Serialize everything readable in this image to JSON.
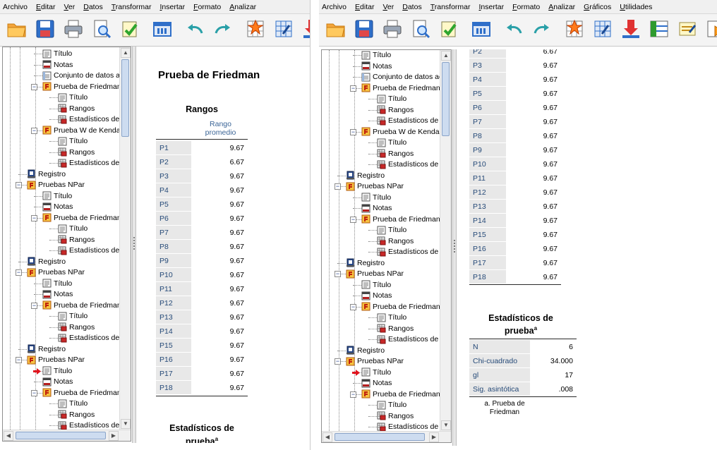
{
  "menu": [
    {
      "pre": "Archivo",
      "u": "",
      "post": ""
    },
    {
      "pre": "",
      "u": "E",
      "post": "ditar"
    },
    {
      "pre": "",
      "u": "V",
      "post": "er"
    },
    {
      "pre": "",
      "u": "D",
      "post": "atos"
    },
    {
      "pre": "",
      "u": "T",
      "post": "ransformar"
    },
    {
      "pre": "",
      "u": "I",
      "post": "nsertar"
    },
    {
      "pre": "",
      "u": "F",
      "post": "ormato"
    },
    {
      "pre": "",
      "u": "A",
      "post": "nalizar"
    },
    {
      "pre": "",
      "u": "G",
      "post": "ráficos"
    },
    {
      "pre": "",
      "u": "U",
      "post": "tilidades"
    }
  ],
  "toolbar_icons": [
    "open-folder-icon",
    "save-icon",
    "print-icon",
    "print-preview-icon",
    "export-icon",
    "dialog-recall-icon",
    "undo-icon",
    "redo-icon",
    "goto-data-icon",
    "goto-case-icon",
    "goto-variable-icon",
    "variables-icon",
    "designate-window-icon",
    "run-script-icon"
  ],
  "tree_left": [
    {
      "label": "Título",
      "level": 2,
      "icon": "title-icon"
    },
    {
      "label": "Notas",
      "level": 2,
      "icon": "notes-icon"
    },
    {
      "label": "Conjunto de datos activo",
      "level": 2,
      "icon": "dataset-icon"
    },
    {
      "label": "Prueba de Friedman",
      "level": 2,
      "icon": "procedure-icon",
      "exp": "-"
    },
    {
      "label": "Título",
      "level": 3,
      "icon": "title-icon"
    },
    {
      "label": "Rangos",
      "level": 3,
      "icon": "table-icon"
    },
    {
      "label": "Estadísticos de prueba",
      "level": 3,
      "icon": "table-icon"
    },
    {
      "label": "Prueba W de Kendall",
      "level": 2,
      "icon": "procedure-icon",
      "exp": "-"
    },
    {
      "label": "Título",
      "level": 3,
      "icon": "title-icon"
    },
    {
      "label": "Rangos",
      "level": 3,
      "icon": "table-icon"
    },
    {
      "label": "Estadísticos de prueba",
      "level": 3,
      "icon": "table-icon"
    },
    {
      "label": "Registro",
      "level": 1,
      "icon": "log-icon"
    },
    {
      "label": "Pruebas NPar",
      "level": 1,
      "icon": "procedure-icon",
      "exp": "-"
    },
    {
      "label": "Título",
      "level": 2,
      "icon": "title-icon"
    },
    {
      "label": "Notas",
      "level": 2,
      "icon": "notes-icon"
    },
    {
      "label": "Prueba de Friedman",
      "level": 2,
      "icon": "procedure-icon",
      "exp": "-"
    },
    {
      "label": "Título",
      "level": 3,
      "icon": "title-icon"
    },
    {
      "label": "Rangos",
      "level": 3,
      "icon": "table-icon"
    },
    {
      "label": "Estadísticos de prueba",
      "level": 3,
      "icon": "table-icon"
    },
    {
      "label": "Registro",
      "level": 1,
      "icon": "log-icon"
    },
    {
      "label": "Pruebas NPar",
      "level": 1,
      "icon": "procedure-icon",
      "exp": "-"
    },
    {
      "label": "Título",
      "level": 2,
      "icon": "title-icon"
    },
    {
      "label": "Notas",
      "level": 2,
      "icon": "notes-icon"
    },
    {
      "label": "Prueba de Friedman",
      "level": 2,
      "icon": "procedure-icon",
      "exp": "-"
    },
    {
      "label": "Título",
      "level": 3,
      "icon": "title-icon"
    },
    {
      "label": "Rangos",
      "level": 3,
      "icon": "table-icon"
    },
    {
      "label": "Estadísticos de prueba",
      "level": 3,
      "icon": "table-icon"
    },
    {
      "label": "Registro",
      "level": 1,
      "icon": "log-icon"
    },
    {
      "label": "Pruebas NPar",
      "level": 1,
      "icon": "procedure-icon",
      "exp": "-"
    },
    {
      "label": "Título",
      "level": 2,
      "icon": "title-icon",
      "current": true
    },
    {
      "label": "Notas",
      "level": 2,
      "icon": "notes-icon"
    },
    {
      "label": "Prueba de Friedman",
      "level": 2,
      "icon": "procedure-icon",
      "exp": "-"
    },
    {
      "label": "Título",
      "level": 3,
      "icon": "title-icon"
    },
    {
      "label": "Rangos",
      "level": 3,
      "icon": "table-icon"
    },
    {
      "label": "Estadísticos de prueba",
      "level": 3,
      "icon": "table-icon"
    }
  ],
  "left_output": {
    "title": "Prueba de Friedman",
    "ranks_title": "Rangos",
    "col_header_1": "Rango",
    "col_header_2": "promedio",
    "rows": [
      {
        "label": "P1",
        "value": "9.67"
      },
      {
        "label": "P2",
        "value": "6.67"
      },
      {
        "label": "P3",
        "value": "9.67"
      },
      {
        "label": "P4",
        "value": "9.67"
      },
      {
        "label": "P5",
        "value": "9.67"
      },
      {
        "label": "P6",
        "value": "9.67"
      },
      {
        "label": "P7",
        "value": "9.67"
      },
      {
        "label": "P8",
        "value": "9.67"
      },
      {
        "label": "P9",
        "value": "9.67"
      },
      {
        "label": "P10",
        "value": "9.67"
      },
      {
        "label": "P11",
        "value": "9.67"
      },
      {
        "label": "P12",
        "value": "9.67"
      },
      {
        "label": "P13",
        "value": "9.67"
      },
      {
        "label": "P14",
        "value": "9.67"
      },
      {
        "label": "P15",
        "value": "9.67"
      },
      {
        "label": "P16",
        "value": "9.67"
      },
      {
        "label": "P17",
        "value": "9.67"
      },
      {
        "label": "P18",
        "value": "9.67"
      }
    ],
    "stats_title_1": "Estadísticos de",
    "stats_title_2": "prueba",
    "stats_sup": "a"
  },
  "right_output": {
    "rows": [
      {
        "label": "P2",
        "value": "6.67"
      },
      {
        "label": "P3",
        "value": "9.67"
      },
      {
        "label": "P4",
        "value": "9.67"
      },
      {
        "label": "P5",
        "value": "9.67"
      },
      {
        "label": "P6",
        "value": "9.67"
      },
      {
        "label": "P7",
        "value": "9.67"
      },
      {
        "label": "P8",
        "value": "9.67"
      },
      {
        "label": "P9",
        "value": "9.67"
      },
      {
        "label": "P10",
        "value": "9.67"
      },
      {
        "label": "P11",
        "value": "9.67"
      },
      {
        "label": "P12",
        "value": "9.67"
      },
      {
        "label": "P13",
        "value": "9.67"
      },
      {
        "label": "P14",
        "value": "9.67"
      },
      {
        "label": "P15",
        "value": "9.67"
      },
      {
        "label": "P16",
        "value": "9.67"
      },
      {
        "label": "P17",
        "value": "9.67"
      },
      {
        "label": "P18",
        "value": "9.67"
      }
    ],
    "stats_title_1": "Estadísticos de",
    "stats_title_2": "prueba",
    "stats_sup": "a",
    "stats": [
      {
        "label": "N",
        "value": "6"
      },
      {
        "label": "Chi-cuadrado",
        "value": "34.000"
      },
      {
        "label": "gl",
        "value": "17"
      },
      {
        "label": "Sig. asintótica",
        "value": ".008"
      }
    ],
    "footnote_1": "a. Prueba de",
    "footnote_2": "Friedman"
  },
  "colors": {
    "header_text": "#3b6597",
    "label_text": "#264a78",
    "label_bg": "#e8e8e8",
    "selection_arrow": "#e0141e"
  }
}
